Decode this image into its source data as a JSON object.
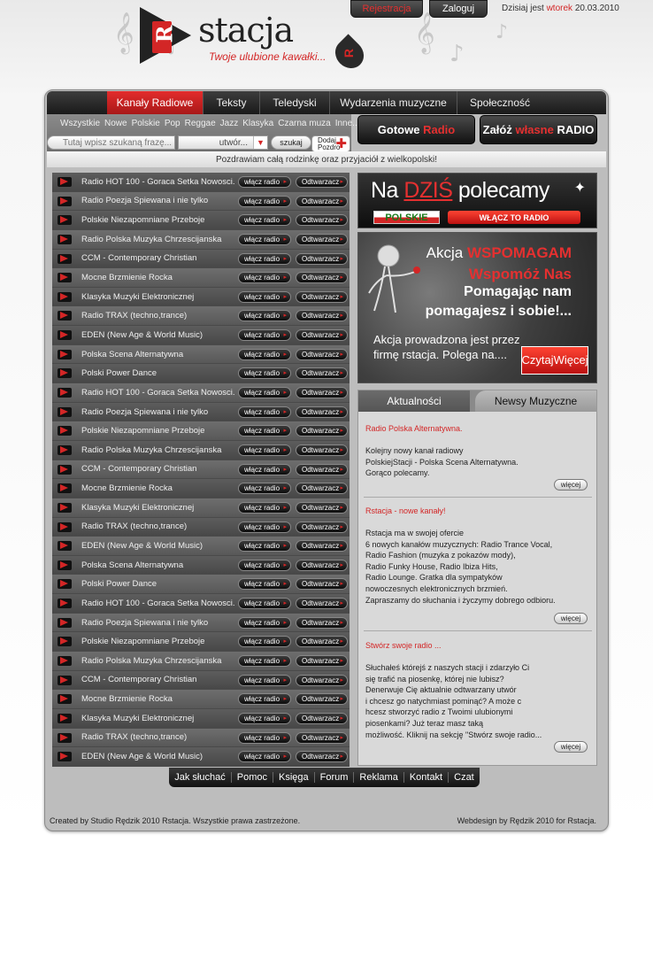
{
  "header": {
    "logo_text": "stacja",
    "logo_letter": "R",
    "tagline": "Twoje ulubione kawałki...",
    "register_label": "Rejestracja",
    "login_label": "Zaloguj",
    "date_prefix": "Dzisiaj jest",
    "date_dow": "wtorek",
    "date_value": "20.03.2010"
  },
  "nav": {
    "tabs": [
      "Kanały Radiowe",
      "Teksty",
      "Teledyski",
      "Wydarzenia muzyczne",
      "Społeczność"
    ],
    "active": "Kanały Radiowe"
  },
  "genres": [
    "Wszystkie",
    "Nowe",
    "Polskie",
    "Pop",
    "Reggae",
    "Jazz",
    "Klasyka",
    "Czarna muza",
    "Inne..."
  ],
  "search": {
    "placeholder": "Tutaj wpisz szukaną frazę...",
    "category": "utwór...",
    "button": "szukaj",
    "greet_line1": "Dodaj",
    "greet_line2": "Pozdro"
  },
  "actions": {
    "ready_white": "Gotowe",
    "ready_red": "Radio",
    "create_white1": "Załóż",
    "create_red": "własne",
    "create_white2": "RADIO"
  },
  "greeting": "Pozdrawiam całą rodzinkę oraz przyjaciół z wielkopolski!",
  "station_buttons": {
    "on": "włącz radio",
    "play": "Odtwarzacz"
  },
  "stations": [
    "Radio HOT 100 - Goraca Setka Nowosci.",
    "Radio Poezja Spiewana i nie tylko",
    "Polskie Niezapomniane Przeboje",
    "Radio Polska Muzyka Chrzescijanska",
    "CCM - Contemporary Christian",
    "Mocne Brzmienie Rocka",
    "Klasyka Muzyki Elektronicznej",
    "Radio TRAX (techno,trance)",
    "EDEN (New Age & World Music)",
    "Polska Scena Alternatywna",
    "Polski Power Dance",
    "Radio HOT 100 - Goraca Setka Nowosci.",
    "Radio Poezja Spiewana i nie tylko",
    "Polskie Niezapomniane Przeboje",
    "Radio Polska Muzyka Chrzescijanska",
    "CCM - Contemporary Christian",
    "Mocne Brzmienie Rocka",
    "Klasyka Muzyki Elektronicznej",
    "Radio TRAX (techno,trance)",
    "EDEN (New Age & World Music)",
    "Polska Scena Alternatywna",
    "Polski Power Dance",
    "Radio HOT 100 - Goraca Setka Nowosci.",
    "Radio Poezja Spiewana i nie tylko",
    "Polskie Niezapomniane Przeboje",
    "Radio Polska Muzyka Chrzescijanska",
    "CCM - Contemporary Christian",
    "Mocne Brzmienie Rocka",
    "Klasyka Muzyki Elektronicznej",
    "Radio TRAX (techno,trance)",
    "EDEN (New Age & World Music)"
  ],
  "promo_today": {
    "title_pre": "Na",
    "title_red": "DZIŚ",
    "title_post": "polecamy",
    "flag_text": "POLSKIE",
    "button": "WŁĄCZ TO RADIO"
  },
  "promo_action": {
    "line1_white": "Akcja",
    "line1_red": "WSPOMAGAM",
    "line2": "Wspomóż Nas",
    "line3": "Pomagając nam",
    "line4": "pomagajesz i sobie!...",
    "desc": "Akcja prowadzona jest przez firmę rstacja. Polega na....",
    "read_more_line1": "Czytaj",
    "read_more_line2": "Więcej"
  },
  "news": {
    "tab_current": "Aktualności",
    "tab_music": "Newsy Muzyczne",
    "more": "więcej",
    "items": [
      {
        "title": "Radio Polska Alternatywna.",
        "text": "Kolejny nowy kanał radiowy\nPolskiejStacji - Polska Scena Alternatywna.\nGorąco polecamy."
      },
      {
        "title": "Rstacja - nowe kanały!",
        "text": "Rstacja ma w swojej ofercie\n6 nowych kanałów muzycznych: Radio Trance Vocal,\nRadio Fashion (muzyka z pokazów mody),\nRadio Funky House, Radio Ibiza Hits,\nRadio Lounge.  Gratka dla sympatyków\nnowoczesnych elektronicznych brzmień.\nZapraszamy do słuchania i życzymy dobrego odbioru."
      },
      {
        "title": "Stwórz swoje radio ...",
        "text": "Słuchałeś którejś z naszych stacji i zdarzyło Ci\nsię trafić na piosenkę, której nie lubisz?\nDenerwuje Cię aktualnie odtwarzany utwór\ni chcesz go natychmiast pominąć? A może c\nhcesz stworzyć radio z Twoimi ulubionymi\npiosenkami? Już teraz masz taką\nmożliwość. Kliknij na sekcję \"Stwórz swoje radio..."
      }
    ]
  },
  "footer": {
    "links": [
      "Jak słuchać",
      "Pomoc",
      "Księga",
      "Forum",
      "Reklama",
      "Kontakt",
      "Czat"
    ],
    "copyright": "Created by Studio Rędzik 2010 Rstacja. Wszystkie prawa zastrzeżone.",
    "webdesign": "Webdesign by Rędzik 2010 for Rstacja."
  },
  "colors": {
    "accent": "#d32626",
    "dark": "#1a1a1a",
    "panel": "#bdbdbd"
  }
}
